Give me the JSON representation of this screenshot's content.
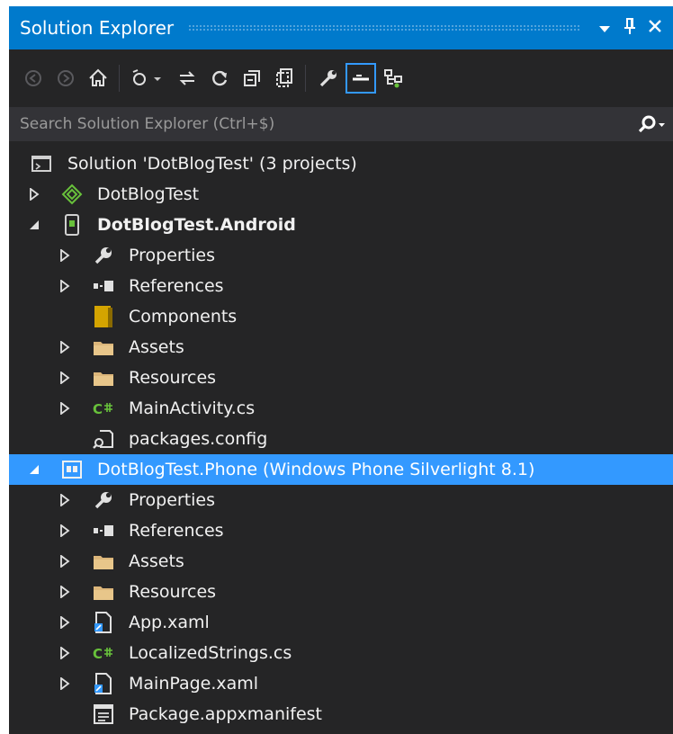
{
  "panel": {
    "title": "Solution Explorer",
    "dropdown_icon": "dropdown-arrow-icon",
    "pin_icon": "pin-icon",
    "close_icon": "close-icon"
  },
  "toolbar": {
    "icons": [
      "back-icon",
      "forward-icon",
      "home-icon",
      "switch-views-icon",
      "sync-icon",
      "refresh-icon",
      "collapse-all-icon",
      "show-all-files-icon",
      "properties-icon",
      "pending-changes-filter-icon",
      "preview-selected-items-icon"
    ]
  },
  "search": {
    "placeholder": "Search Solution Explorer (Ctrl+$)"
  },
  "tree": [
    {
      "label": "Solution 'DotBlogTest' (3 projects)",
      "icon": "solution-icon",
      "indent": 0,
      "expander": "none",
      "bold": false,
      "selected": false
    },
    {
      "label": "DotBlogTest",
      "icon": "shared-project-icon",
      "indent": 0,
      "expander": "collapsed",
      "bold": false,
      "selected": false
    },
    {
      "label": "DotBlogTest.Android",
      "icon": "android-project-icon",
      "indent": 0,
      "expander": "expanded",
      "bold": true,
      "selected": false
    },
    {
      "label": "Properties",
      "icon": "wrench-icon",
      "indent": 1,
      "expander": "collapsed",
      "bold": false,
      "selected": false
    },
    {
      "label": "References",
      "icon": "references-icon",
      "indent": 1,
      "expander": "collapsed",
      "bold": false,
      "selected": false
    },
    {
      "label": "Components",
      "icon": "components-icon",
      "indent": 1,
      "expander": "none",
      "bold": false,
      "selected": false
    },
    {
      "label": "Assets",
      "icon": "folder-icon",
      "indent": 1,
      "expander": "collapsed",
      "bold": false,
      "selected": false
    },
    {
      "label": "Resources",
      "icon": "folder-icon",
      "indent": 1,
      "expander": "collapsed",
      "bold": false,
      "selected": false
    },
    {
      "label": "MainActivity.cs",
      "icon": "csharp-file-icon",
      "indent": 1,
      "expander": "collapsed",
      "bold": false,
      "selected": false
    },
    {
      "label": "packages.config",
      "icon": "config-file-icon",
      "indent": 1,
      "expander": "none",
      "bold": false,
      "selected": false
    },
    {
      "label": "DotBlogTest.Phone (Windows Phone Silverlight 8.1)",
      "icon": "phone-project-icon",
      "indent": 0,
      "expander": "expanded",
      "bold": false,
      "selected": true
    },
    {
      "label": "Properties",
      "icon": "wrench-icon",
      "indent": 1,
      "expander": "collapsed",
      "bold": false,
      "selected": false
    },
    {
      "label": "References",
      "icon": "references-icon",
      "indent": 1,
      "expander": "collapsed",
      "bold": false,
      "selected": false
    },
    {
      "label": "Assets",
      "icon": "folder-icon",
      "indent": 1,
      "expander": "collapsed",
      "bold": false,
      "selected": false
    },
    {
      "label": "Resources",
      "icon": "folder-icon",
      "indent": 1,
      "expander": "collapsed",
      "bold": false,
      "selected": false
    },
    {
      "label": "App.xaml",
      "icon": "xaml-file-icon",
      "indent": 1,
      "expander": "collapsed",
      "bold": false,
      "selected": false
    },
    {
      "label": "LocalizedStrings.cs",
      "icon": "csharp-file-icon",
      "indent": 1,
      "expander": "collapsed",
      "bold": false,
      "selected": false
    },
    {
      "label": "MainPage.xaml",
      "icon": "xaml-file-icon",
      "indent": 1,
      "expander": "collapsed",
      "bold": false,
      "selected": false
    },
    {
      "label": "Package.appxmanifest",
      "icon": "manifest-file-icon",
      "indent": 1,
      "expander": "none",
      "bold": false,
      "selected": false
    }
  ],
  "colors": {
    "accent": "#007acc",
    "selection": "#3399ff",
    "background": "#252526",
    "folder": "#dcb67a",
    "csharp": "#68c13b"
  }
}
